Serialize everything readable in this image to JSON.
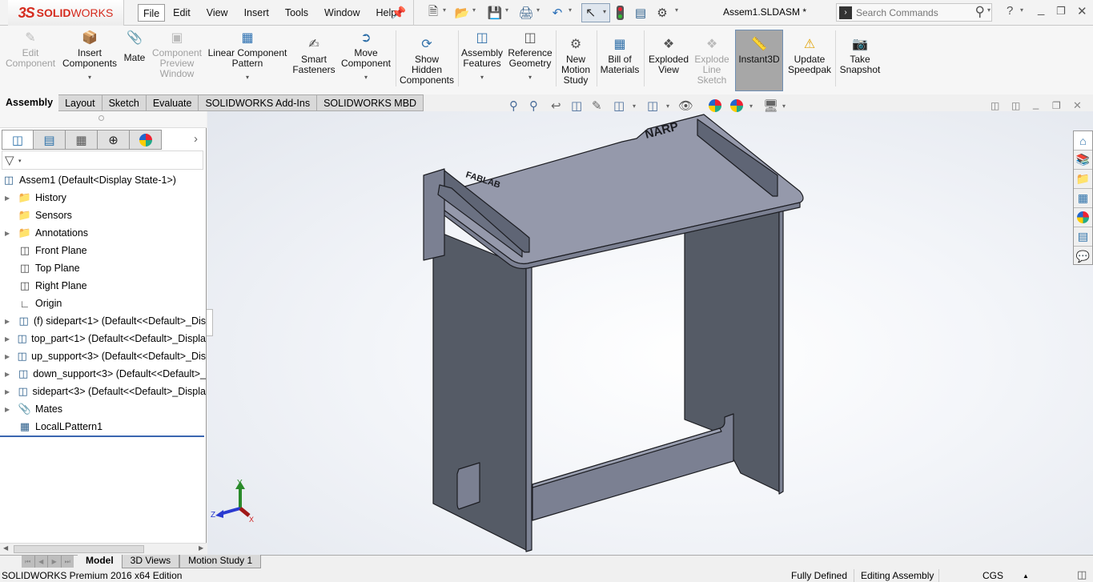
{
  "app": {
    "logo_ds": "3S",
    "logo_solid": "SOLID",
    "logo_works": "WORKS",
    "document_title": "Assem1.SLDASM *"
  },
  "menu": [
    {
      "label": "File",
      "active": true
    },
    {
      "label": "Edit"
    },
    {
      "label": "View"
    },
    {
      "label": "Insert"
    },
    {
      "label": "Tools"
    },
    {
      "label": "Window"
    },
    {
      "label": "Help"
    }
  ],
  "search": {
    "placeholder": "Search Commands"
  },
  "command_manager": {
    "items": [
      {
        "label": "Edit Component",
        "lines": [
          "Edit",
          "Component"
        ],
        "enabled": false
      },
      {
        "label": "Insert Components",
        "lines": [
          "Insert",
          "Components"
        ],
        "enabled": true
      },
      {
        "label": "Mate",
        "lines": [
          "Mate"
        ],
        "enabled": true
      },
      {
        "label": "Component Preview Window",
        "lines": [
          "Component",
          "Preview",
          "Window"
        ],
        "enabled": false
      },
      {
        "label": "Linear Component Pattern",
        "lines": [
          "Linear Component",
          "Pattern"
        ],
        "enabled": true
      },
      {
        "label": "Smart Fasteners",
        "lines": [
          "Smart",
          "Fasteners"
        ],
        "enabled": true
      },
      {
        "label": "Move Component",
        "lines": [
          "Move",
          "Component"
        ],
        "enabled": true
      },
      {
        "label": "Show Hidden Components",
        "lines": [
          "Show",
          "Hidden",
          "Components"
        ],
        "enabled": true
      },
      {
        "label": "Assembly Features",
        "lines": [
          "Assembly",
          "Features"
        ],
        "enabled": true
      },
      {
        "label": "Reference Geometry",
        "lines": [
          "Reference",
          "Geometry"
        ],
        "enabled": true
      },
      {
        "label": "New Motion Study",
        "lines": [
          "New",
          "Motion",
          "Study"
        ],
        "enabled": true
      },
      {
        "label": "Bill of Materials",
        "lines": [
          "Bill of",
          "Materials"
        ],
        "enabled": true
      },
      {
        "label": "Exploded View",
        "lines": [
          "Exploded",
          "View"
        ],
        "enabled": true
      },
      {
        "label": "Explode Line Sketch",
        "lines": [
          "Explode",
          "Line",
          "Sketch"
        ],
        "enabled": false
      },
      {
        "label": "Instant3D",
        "lines": [
          "Instant3D"
        ],
        "enabled": true,
        "active": true
      },
      {
        "label": "Update Speedpak",
        "lines": [
          "Update",
          "Speedpak"
        ],
        "enabled": true
      },
      {
        "label": "Take Snapshot",
        "lines": [
          "Take",
          "Snapshot"
        ],
        "enabled": true
      }
    ],
    "tabs": [
      {
        "label": "Assembly",
        "active": true
      },
      {
        "label": "Layout"
      },
      {
        "label": "Sketch"
      },
      {
        "label": "Evaluate"
      },
      {
        "label": "SOLIDWORKS Add-Ins"
      },
      {
        "label": "SOLIDWORKS MBD"
      }
    ]
  },
  "feature_tree": {
    "root": "Assem1  (Default<Display State-1>)",
    "items": [
      {
        "label": "History",
        "icon": "history-folder-icon",
        "expandable": true
      },
      {
        "label": "Sensors",
        "icon": "sensors-folder-icon",
        "expandable": false
      },
      {
        "label": "Annotations",
        "icon": "annotations-folder-icon",
        "expandable": true
      },
      {
        "label": "Front Plane",
        "icon": "plane-icon",
        "expandable": false
      },
      {
        "label": "Top Plane",
        "icon": "plane-icon",
        "expandable": false
      },
      {
        "label": "Right Plane",
        "icon": "plane-icon",
        "expandable": false
      },
      {
        "label": "Origin",
        "icon": "origin-icon",
        "expandable": false
      },
      {
        "label": "(f) sidepart<1> (Default<<Default>_Dis",
        "icon": "part-icon",
        "expandable": true
      },
      {
        "label": "top_part<1> (Default<<Default>_Displa",
        "icon": "part-icon",
        "expandable": true
      },
      {
        "label": "up_support<3> (Default<<Default>_Dis",
        "icon": "part-icon",
        "expandable": true
      },
      {
        "label": "down_support<3> (Default<<Default>_",
        "icon": "part-icon",
        "expandable": true
      },
      {
        "label": "sidepart<3> (Default<<Default>_Displa",
        "icon": "part-icon",
        "expandable": true
      },
      {
        "label": "Mates",
        "icon": "mates-icon",
        "expandable": true
      },
      {
        "label": "LocalLPattern1",
        "icon": "pattern-icon",
        "expandable": false
      }
    ]
  },
  "viewport": {
    "model_text_1": "NARP",
    "model_text_2": "FABLAB",
    "axis_x": "X",
    "axis_y": "Y",
    "axis_z": "Z"
  },
  "bottom_tabs": [
    {
      "label": "Model",
      "active": true
    },
    {
      "label": "3D Views"
    },
    {
      "label": "Motion Study 1"
    }
  ],
  "status": {
    "edition": "SOLIDWORKS Premium 2016 x64 Edition",
    "definition": "Fully Defined",
    "mode": "Editing Assembly",
    "units": "CGS"
  }
}
